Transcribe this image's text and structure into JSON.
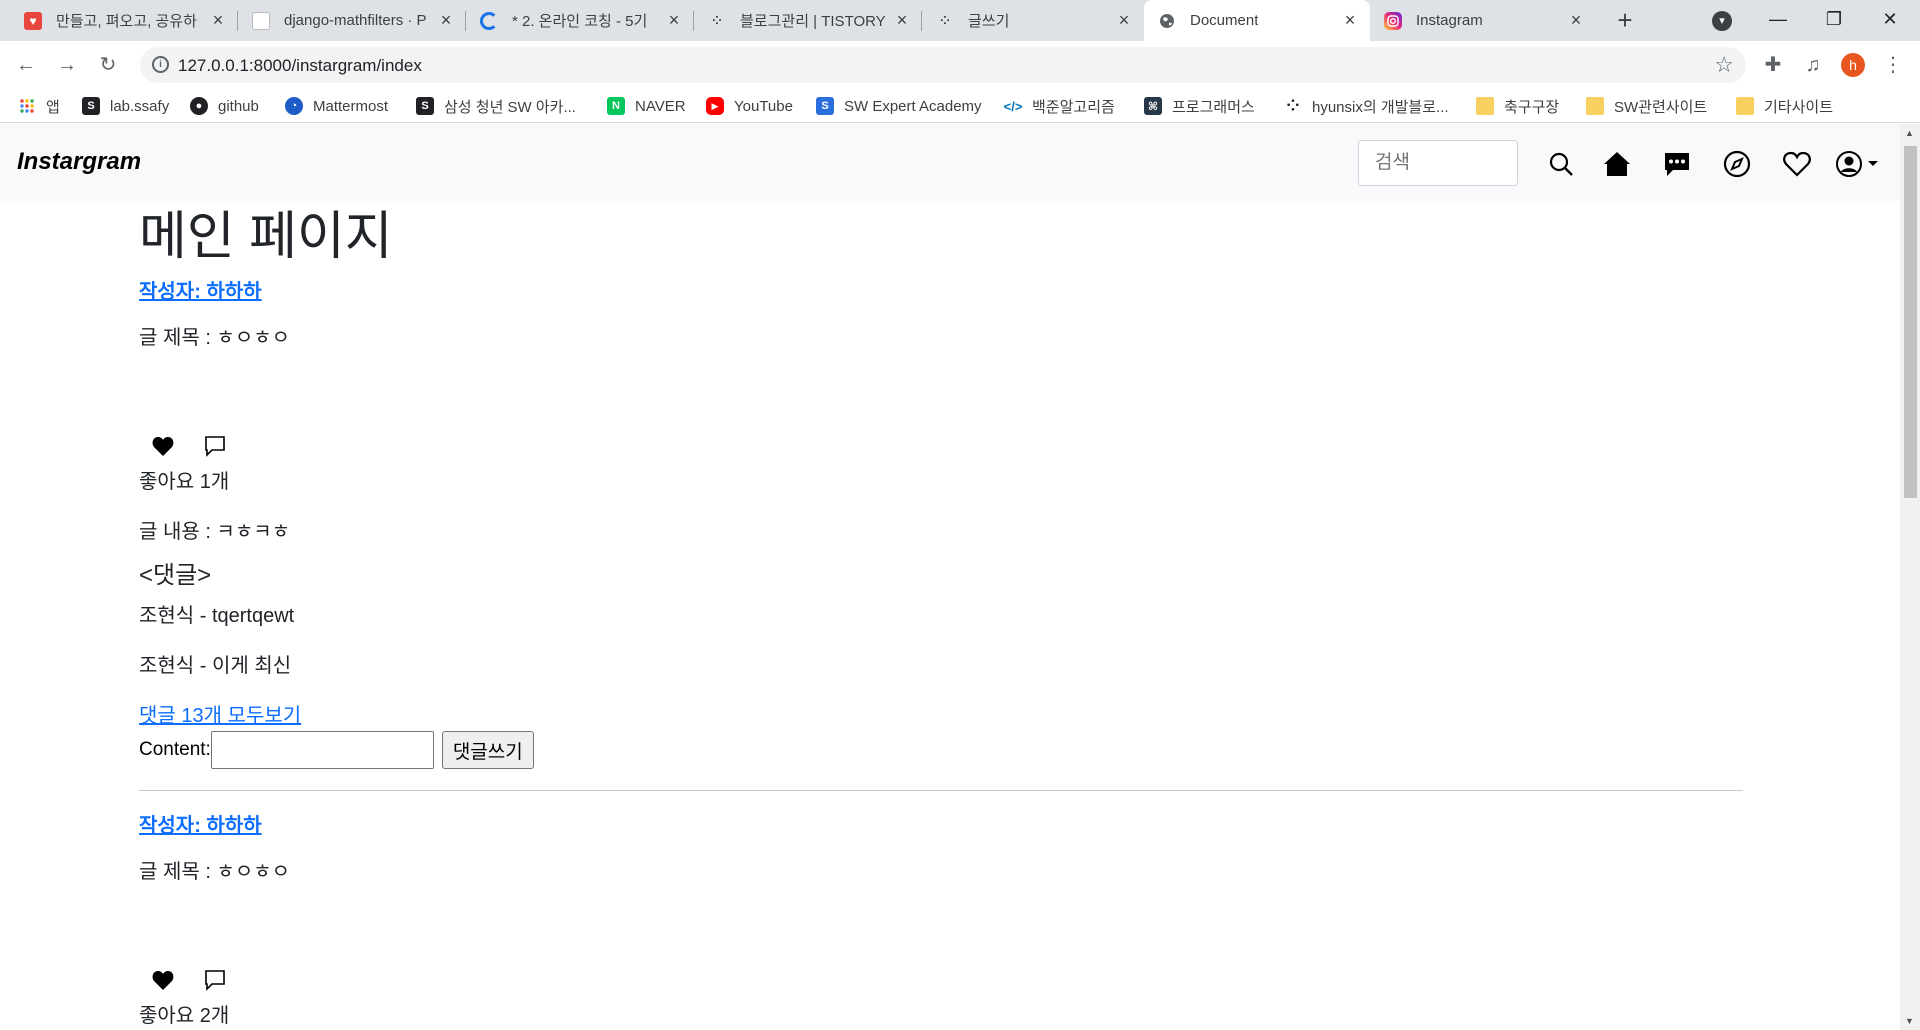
{
  "browser": {
    "tabs": [
      {
        "title": "만들고, 펴오고, 공유하",
        "favicon": "shield",
        "color": "#e8453c",
        "active": false
      },
      {
        "title": "django-mathfilters · P",
        "favicon": "page",
        "color": "#ffffff",
        "active": false
      },
      {
        "title": "* 2. 온라인 코칭 - 5기",
        "favicon": "loading",
        "color": "#1a73e8",
        "active": false
      },
      {
        "title": "블로그관리 | TISTORY",
        "favicon": "dots",
        "color": "#202124",
        "active": false
      },
      {
        "title": "글쓰기",
        "favicon": "dots",
        "color": "#202124",
        "active": false
      },
      {
        "title": "Document",
        "favicon": "globe",
        "color": "#5f6368",
        "active": true
      },
      {
        "title": "Instagram",
        "favicon": "instagram",
        "color": "#d6249f",
        "active": false
      }
    ],
    "address": {
      "url": "127.0.0.1:8000/instargram/index"
    },
    "profile_initial": "h",
    "bookmarks": [
      {
        "label": "앱",
        "icon": "apps-grid-icon",
        "color": "#ea4335"
      },
      {
        "label": "lab.ssafy",
        "icon": "ssafy-icon",
        "color": "#202124"
      },
      {
        "label": "github",
        "icon": "github-icon",
        "color": "#202124"
      },
      {
        "label": "Mattermost",
        "icon": "mattermost-icon",
        "color": "#1e5cc8"
      },
      {
        "label": "삼성 청년 SW 아카...",
        "icon": "ssafy-icon",
        "color": "#202124"
      },
      {
        "label": "NAVER",
        "icon": "naver-icon",
        "color": "#03c75a"
      },
      {
        "label": "YouTube",
        "icon": "youtube-icon",
        "color": "#ff0000"
      },
      {
        "label": "SW Expert Academy",
        "icon": "swea-icon",
        "color": "#2a6fdb"
      },
      {
        "label": "백준알고리즘",
        "icon": "code-icon",
        "color": "#0076c0"
      },
      {
        "label": "프로그래머스",
        "icon": "programmers-icon",
        "color": "#263747"
      },
      {
        "label": "hyunsix의 개발블로...",
        "icon": "tistory-icon",
        "color": "#202124"
      },
      {
        "label": "축구구장",
        "icon": "folder-icon",
        "color": "#f7d060"
      },
      {
        "label": "SW관련사이트",
        "icon": "folder-icon",
        "color": "#f7d060"
      },
      {
        "label": "기타사이트",
        "icon": "folder-icon",
        "color": "#f7d060"
      }
    ]
  },
  "navbar": {
    "brand": "Instargram",
    "search_placeholder": "검색"
  },
  "page": {
    "title": "메인 페이지",
    "posts": [
      {
        "author": "작성자: 하하하",
        "subject": "글 제목 : ㅎㅇㅎㅇ",
        "likes": "좋아요 1개",
        "body": "글 내용 : ㅋㅎㅋㅎ",
        "comments_heading": "<댓글>",
        "comments": [
          "조현식 - tqertqewt",
          "조현식 - 이게 최신"
        ],
        "more_comments": "댓글 13개 모두보기",
        "form_label": "Content:",
        "submit": "댓글쓰기"
      },
      {
        "author": "작성자: 하하하",
        "subject": "글 제목 : ㅎㅇㅎㅇ",
        "likes": "좋아요 2개"
      }
    ]
  }
}
